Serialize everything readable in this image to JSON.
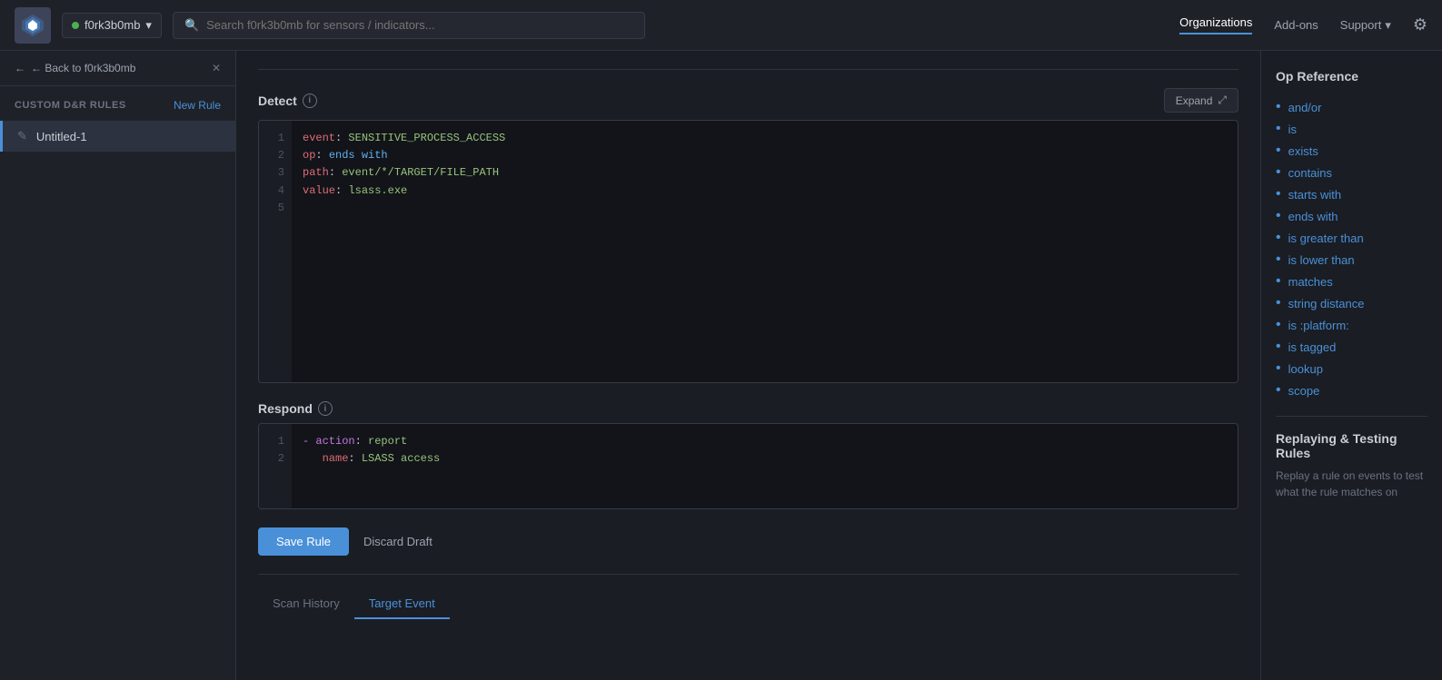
{
  "topnav": {
    "org_name": "f0rk3b0mb",
    "org_dot_color": "#4caf50",
    "search_placeholder": "Search f0rk3b0mb for sensors / indicators...",
    "nav_links": [
      {
        "label": "Organizations",
        "active": true
      },
      {
        "label": "Add-ons",
        "active": false
      },
      {
        "label": "Support",
        "active": false,
        "has_dropdown": true
      }
    ],
    "gear_label": "⚙"
  },
  "sidebar": {
    "back_label": "← Back to f0rk3b0mb",
    "close_label": "✕",
    "section_title": "CUSTOM D&R RULES",
    "new_rule_label": "New Rule",
    "items": [
      {
        "icon": "✎",
        "label": "Untitled-1"
      }
    ]
  },
  "detect_section": {
    "title": "Detect",
    "expand_label": "Expand",
    "lines": [
      "1",
      "2",
      "3",
      "4",
      "5"
    ],
    "code": "event: SENSITIVE_PROCESS_ACCESS\nop: ends with\npath: event/*/TARGET/FILE_PATH\nvalue: lsass.exe\n"
  },
  "respond_section": {
    "title": "Respond",
    "lines": [
      "1",
      "2"
    ],
    "code": "- action: report\n   name: LSASS access"
  },
  "buttons": {
    "save_label": "Save Rule",
    "discard_label": "Discard Draft"
  },
  "bottom_tabs": [
    {
      "label": "Scan History",
      "active": false
    },
    {
      "label": "Target Event",
      "active": true
    }
  ],
  "op_reference": {
    "title": "Op Reference",
    "items": [
      "and/or",
      "is",
      "exists",
      "contains",
      "starts with",
      "ends with",
      "is greater than",
      "is lower than",
      "matches",
      "string distance",
      "is :platform:",
      "is tagged",
      "lookup",
      "scope"
    ]
  },
  "replay_section": {
    "title": "Replaying & Testing Rules",
    "description": "Replay a rule on events to test what the rule matches on"
  }
}
